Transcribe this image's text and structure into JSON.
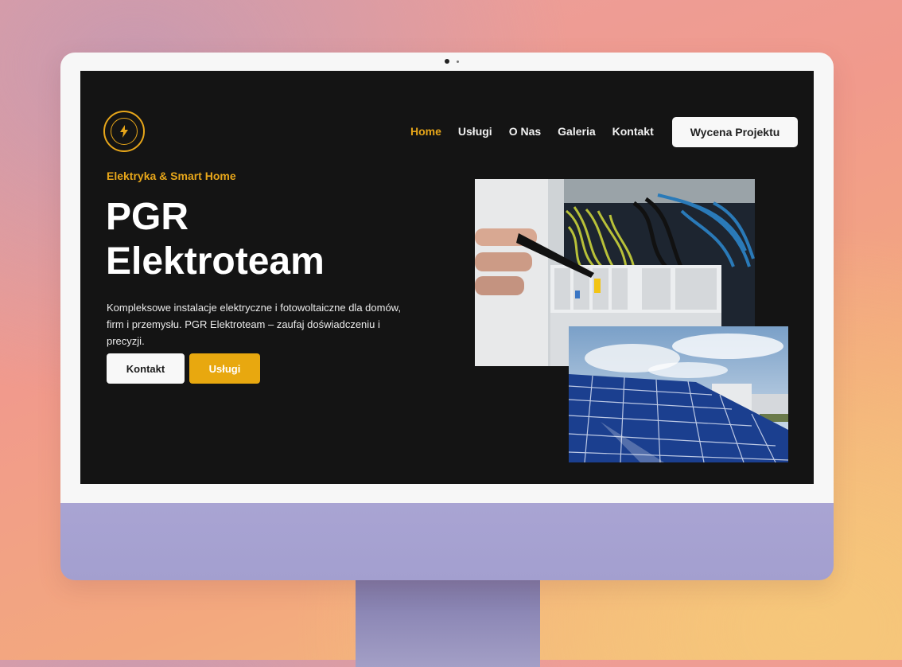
{
  "nav": {
    "items": [
      "Home",
      "Usługi",
      "O Nas",
      "Galeria",
      "Kontakt"
    ],
    "active": "Home",
    "cta": "Wycena Projektu"
  },
  "hero": {
    "eyebrow": "Elektryka & Smart Home",
    "title_line1": "PGR",
    "title_line2": "Elektroteam",
    "description": "Kompleksowe instalacje elektryczne i fotowoltaiczne dla domów, firm i przemysłu. PGR Elektroteam – zaufaj doświadczeniu i precyzji.",
    "button_primary": "Kontakt",
    "button_secondary": "Usługi"
  },
  "colors": {
    "accent": "#e7a61a",
    "screen_bg": "#141414",
    "monitor_chin": "#a9a4d3"
  },
  "icons": {
    "logo": "lightning-bolt-seal-icon"
  }
}
